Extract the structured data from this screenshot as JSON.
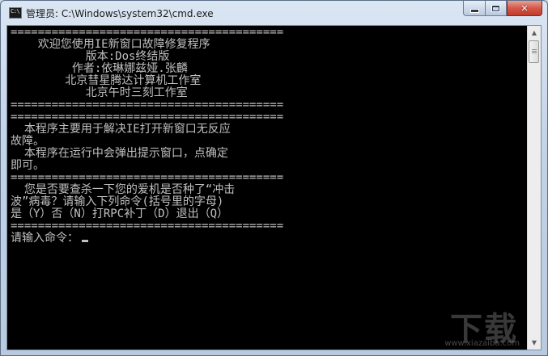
{
  "window": {
    "title": "管理员: C:\\Windows\\system32\\cmd.exe",
    "icon_label": "C:\\",
    "icon": "cmd-icon"
  },
  "caption_buttons": {
    "minimize_icon": "minimize-icon",
    "maximize_icon": "maximize-icon",
    "close_icon": "close-icon",
    "close_glyph": "✕"
  },
  "console": {
    "lines": [
      "========================================",
      "    欢迎您使用IE新窗口故障修复程序",
      "           版本:Dos终结版",
      "         作者:依琳娜兹娅.张麟",
      "        北京彗星腾达计算机工作室",
      "           北京午时三刻工作室",
      "========================================",
      "========================================",
      "  本程序主要用于解决IE打开新窗口无反应",
      "故障。",
      "  本程序在运行中会弹出提示窗口，点确定",
      "即可。",
      "========================================",
      "  您是否要查杀一下您的爱机是否种了“冲击",
      "波”病毒？请输入下列命令(括号里的字母)",
      "是（Y）否（N）打RPC补丁（D）退出（Q）",
      "========================================",
      "请输入命令："
    ]
  },
  "scrollbar": {
    "up_arrow": "▲",
    "down_arrow": "▼"
  },
  "watermark": {
    "logo": "下载",
    "url": "www.xiazaiba.com"
  },
  "colors": {
    "console_bg": "#000000",
    "console_fg": "#c0c0c0",
    "close_button": "#c8463a"
  }
}
